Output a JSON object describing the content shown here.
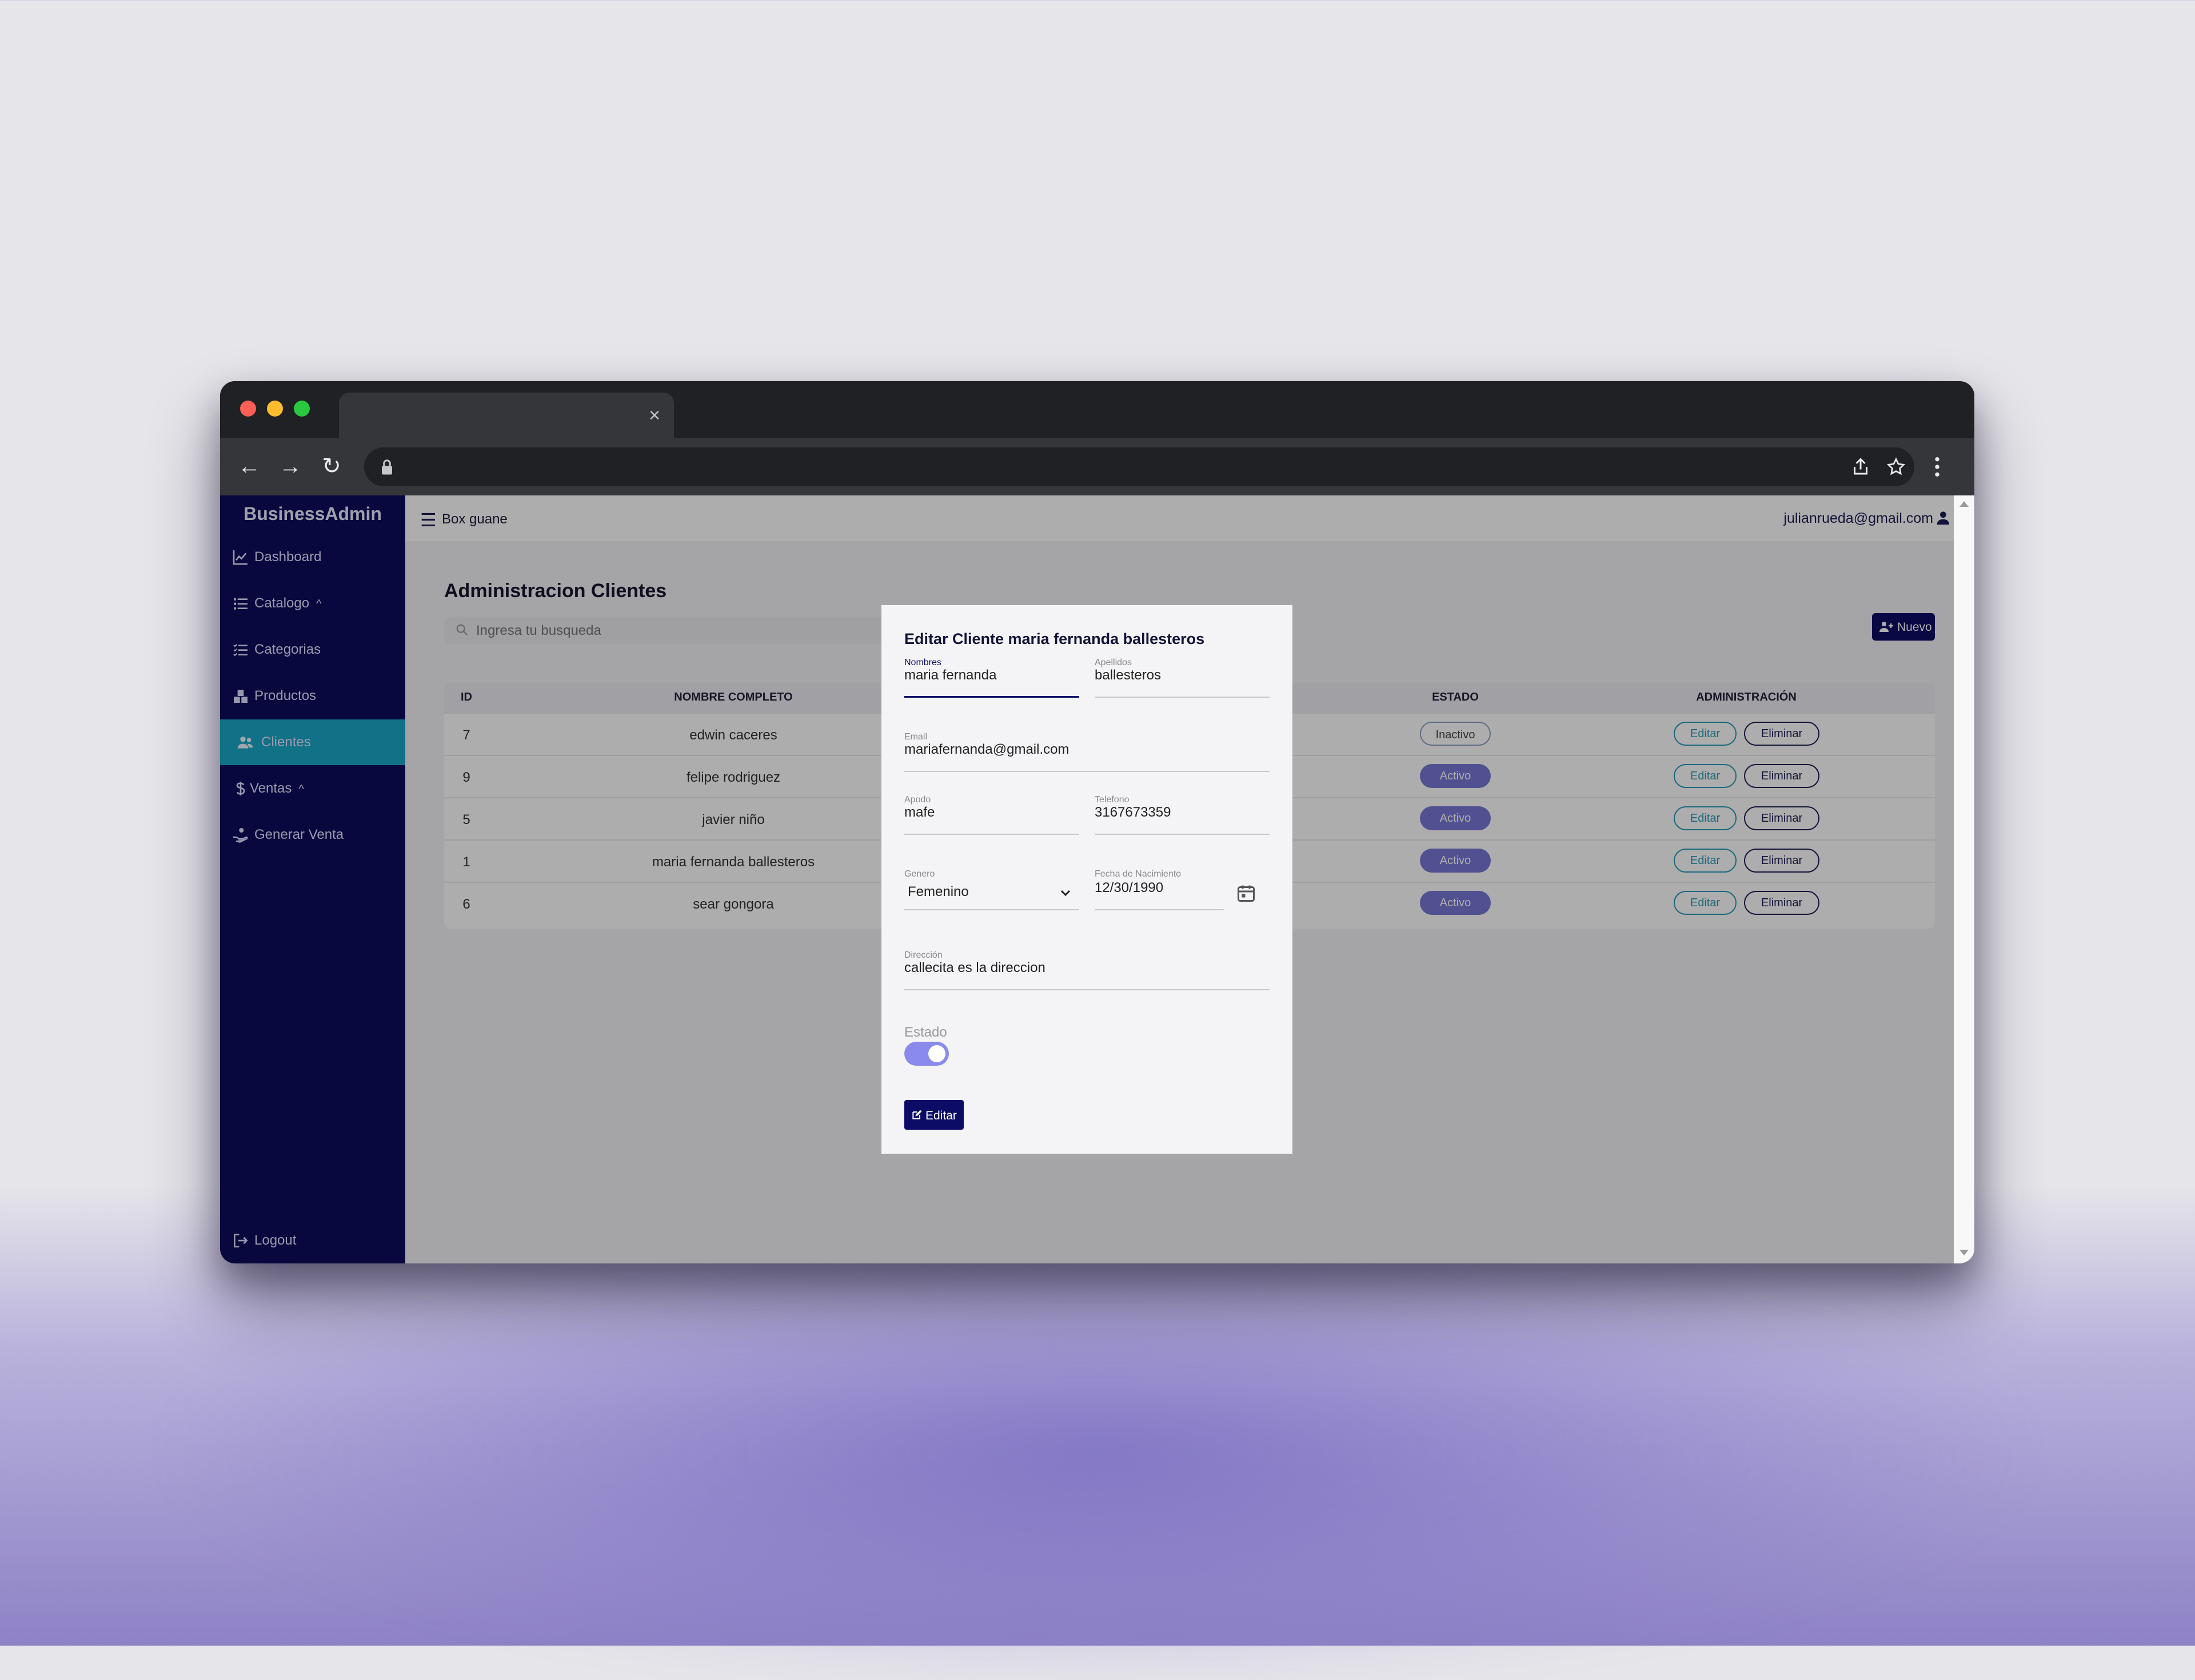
{
  "browser": {
    "tab_close": "×",
    "nav": {
      "back": "←",
      "forward": "→",
      "reload": "↻"
    },
    "toolbar_icons": [
      "lock-icon",
      "share-icon",
      "bookmark-star-icon",
      "kebab-menu-icon"
    ]
  },
  "sidebar": {
    "brand": "BusinessAdmin",
    "items": [
      {
        "label": "Dashboard",
        "icon": "chart-line-icon"
      },
      {
        "label": "Catalogo",
        "icon": "list-icon",
        "chevron": "^"
      },
      {
        "label": "Categorias",
        "icon": "list-check-icon"
      },
      {
        "label": "Productos",
        "icon": "boxes-icon"
      },
      {
        "label": "Clientes",
        "icon": "users-icon",
        "active": true
      },
      {
        "label": "Ventas",
        "icon": "dollar-icon",
        "chevron": "^"
      },
      {
        "label": "Generar Venta",
        "icon": "hand-holding-icon"
      }
    ],
    "logout": "Logout"
  },
  "topbar": {
    "company": "Box guane",
    "user_email": "julianrueda@gmail.com"
  },
  "page": {
    "title": "Administracion Clientes",
    "search_placeholder": "Ingresa tu busqueda",
    "new_button": "Nuevo"
  },
  "table": {
    "headers": {
      "id": "ID",
      "name": "NOMBRE COMPLETO",
      "status": "ESTADO",
      "admin": "ADMINISTRACIÓN"
    },
    "rows": [
      {
        "id": "7",
        "name": "edwin caceres",
        "status": "Inactivo",
        "active": false
      },
      {
        "id": "9",
        "name": "felipe rodriguez",
        "status": "Activo",
        "active": true
      },
      {
        "id": "5",
        "name": "javier niño",
        "status": "Activo",
        "active": true
      },
      {
        "id": "1",
        "name": "maria fernanda ballesteros",
        "status": "Activo",
        "active": true
      },
      {
        "id": "6",
        "name": "sear gongora",
        "status": "Activo",
        "active": true
      }
    ],
    "edit_label": "Editar",
    "delete_label": "Eliminar"
  },
  "modal": {
    "title": "Editar Cliente maria fernanda ballesteros",
    "fields": {
      "nombres": {
        "label": "Nombres",
        "value": "maria fernanda"
      },
      "apellidos": {
        "label": "Apellidos",
        "value": "ballesteros"
      },
      "email": {
        "label": "Email",
        "value": "mariafernanda@gmail.com"
      },
      "apodo": {
        "label": "Apodo",
        "value": "mafe"
      },
      "telefono": {
        "label": "Telefono",
        "value": "3167673359"
      },
      "genero": {
        "label": "Genero",
        "value": "Femenino"
      },
      "fecha": {
        "label": "Fecha de Nacimiento",
        "value": "12/30/1990"
      },
      "direccion": {
        "label": "Dirección",
        "value": "callecita es la direccion"
      }
    },
    "estado_label": "Estado",
    "estado_on": true,
    "submit": "Editar"
  },
  "colors": {
    "sidebar_bg": "#0d0d5c",
    "active_item": "#1aa7c6",
    "primary": "#0c0c66",
    "badge_active": "#7878d8",
    "toggle_on": "#8a8aec"
  }
}
